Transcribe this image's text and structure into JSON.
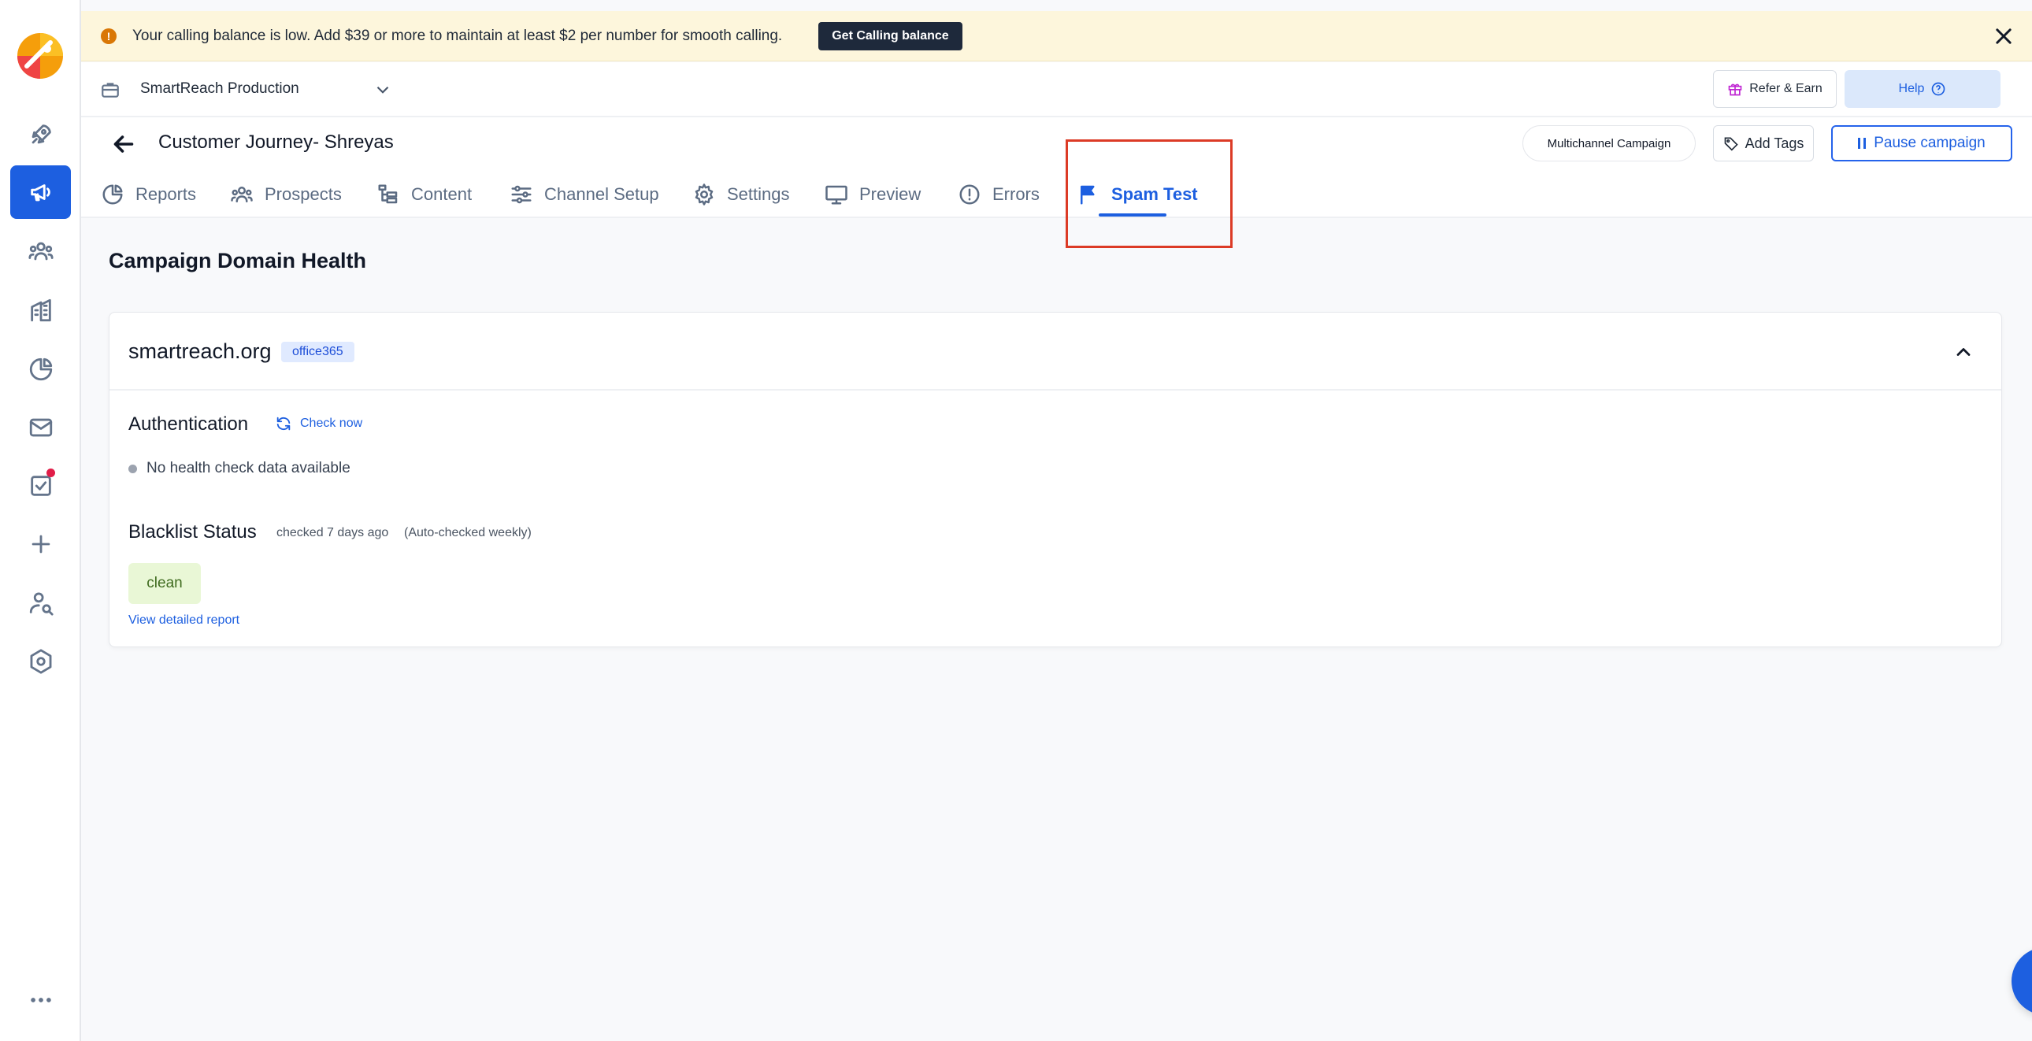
{
  "banner": {
    "message": "Your calling balance is low. Add $39 or more to maintain at least $2 per number for smooth calling.",
    "button_label": "Get Calling balance"
  },
  "workspace": {
    "name": "SmartReach Production",
    "refer_label": "Refer & Earn",
    "help_label": "Help"
  },
  "campaign": {
    "title": "Customer Journey- Shreyas",
    "type_label": "Multichannel Campaign",
    "tags_label": "Add Tags",
    "pause_label": "Pause campaign"
  },
  "tabs": [
    {
      "label": "Reports",
      "icon": "pie-chart-icon"
    },
    {
      "label": "Prospects",
      "icon": "users-icon"
    },
    {
      "label": "Content",
      "icon": "tree-icon"
    },
    {
      "label": "Channel Setup",
      "icon": "sliders-icon"
    },
    {
      "label": "Settings",
      "icon": "gear-icon"
    },
    {
      "label": "Preview",
      "icon": "monitor-icon"
    },
    {
      "label": "Errors",
      "icon": "alert-circle-icon"
    },
    {
      "label": "Spam Test",
      "icon": "flag-icon",
      "active": true
    }
  ],
  "section": {
    "title": "Campaign Domain Health"
  },
  "domain": {
    "name": "smartreach.org",
    "provider": "office365",
    "auth_title": "Authentication",
    "check_now_label": "Check now",
    "no_data_text": "No health check data available",
    "blacklist_title": "Blacklist Status",
    "checked_text": "checked 7 days ago",
    "auto_text": "(Auto-checked weekly)",
    "status": "clean",
    "report_link": "View detailed report"
  },
  "colors": {
    "primary": "#1d5fe0",
    "banner_bg": "#fdf6dc",
    "highlight": "#dc3b26",
    "clean_bg": "#e9f7d6"
  }
}
